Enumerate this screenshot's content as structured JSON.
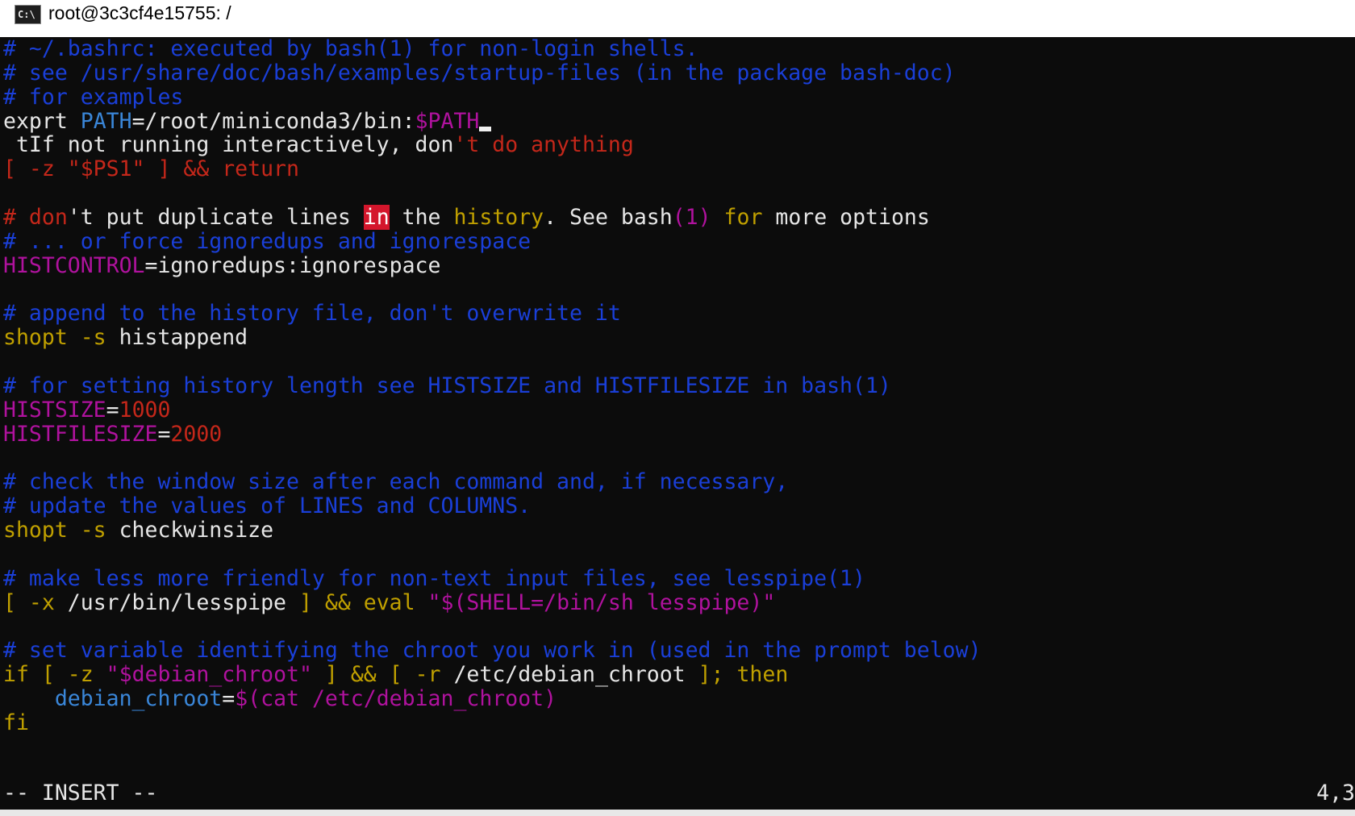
{
  "window": {
    "title": "root@3c3cf4e15755: /",
    "icon_name": "cmd-icon",
    "icon_label": "C:\\"
  },
  "editor": {
    "mode": "-- INSERT --",
    "cursor_position": "4,3"
  },
  "colors": {
    "comment": "#1a3fd8",
    "variable": "#b0129e",
    "string": "#c4271a",
    "keyword": "#c0a000",
    "identifier": "#3a86d8",
    "highlight": "#d4162c"
  },
  "lines": [
    [
      {
        "t": "# ~/.bashrc: executed by bash(1) for non-login shells.",
        "c": "com"
      }
    ],
    [
      {
        "t": "# see /usr/share/doc/bash/examples/startup-files (in the package bash-doc)",
        "c": "com"
      }
    ],
    [
      {
        "t": "# for examples",
        "c": "com"
      }
    ],
    [
      {
        "t": "exprt ",
        "c": "wht"
      },
      {
        "t": "PATH",
        "c": "blu"
      },
      {
        "t": "=/root/miniconda3/bin:",
        "c": "wht"
      },
      {
        "t": "$PATH",
        "c": "mag"
      },
      {
        "t": "",
        "c": "cursor"
      }
    ],
    [
      {
        "t": " tIf not running interactively, don",
        "c": "wht"
      },
      {
        "t": "'t do anything",
        "c": "red"
      }
    ],
    [
      {
        "t": "[ -z \"$PS1\" ] && return",
        "c": "red"
      }
    ],
    [],
    [
      {
        "t": "# ",
        "c": "red"
      },
      {
        "t": "don",
        "c": "red"
      },
      {
        "t": "'t put duplicate lines ",
        "c": "wht"
      },
      {
        "t": "in",
        "c": "hl"
      },
      {
        "t": " the ",
        "c": "wht"
      },
      {
        "t": "history",
        "c": "yel"
      },
      {
        "t": ". See bash",
        "c": "wht"
      },
      {
        "t": "(1)",
        "c": "mag"
      },
      {
        "t": " ",
        "c": "wht"
      },
      {
        "t": "for",
        "c": "yel"
      },
      {
        "t": " more options",
        "c": "wht"
      }
    ],
    [
      {
        "t": "# ... or force ignoredups and ignorespace",
        "c": "com"
      }
    ],
    [
      {
        "t": "HISTCONTROL",
        "c": "mag"
      },
      {
        "t": "=ignoredups:ignorespace",
        "c": "wht"
      }
    ],
    [],
    [
      {
        "t": "# append to the history file, don't overwrite it",
        "c": "com"
      }
    ],
    [
      {
        "t": "shopt -s",
        "c": "yel"
      },
      {
        "t": " histappend",
        "c": "wht"
      }
    ],
    [],
    [
      {
        "t": "# for setting history length see HISTSIZE and HISTFILESIZE in bash(1)",
        "c": "com"
      }
    ],
    [
      {
        "t": "HISTSIZE",
        "c": "mag"
      },
      {
        "t": "=",
        "c": "wht"
      },
      {
        "t": "1000",
        "c": "red"
      }
    ],
    [
      {
        "t": "HISTFILESIZE",
        "c": "mag"
      },
      {
        "t": "=",
        "c": "wht"
      },
      {
        "t": "2000",
        "c": "red"
      }
    ],
    [],
    [
      {
        "t": "# check the window size after each command and, if necessary,",
        "c": "com"
      }
    ],
    [
      {
        "t": "# update the values of LINES and COLUMNS.",
        "c": "com"
      }
    ],
    [
      {
        "t": "shopt -s",
        "c": "yel"
      },
      {
        "t": " checkwinsize",
        "c": "wht"
      }
    ],
    [],
    [
      {
        "t": "# make less more friendly for non-text input files, see lesspipe(1)",
        "c": "com"
      }
    ],
    [
      {
        "t": "[ -x",
        "c": "yel"
      },
      {
        "t": " /usr/bin/lesspipe ",
        "c": "wht"
      },
      {
        "t": "] && eval",
        "c": "yel"
      },
      {
        "t": " ",
        "c": "wht"
      },
      {
        "t": "\"$(SHELL=/bin/sh lesspipe)\"",
        "c": "mag"
      }
    ],
    [],
    [
      {
        "t": "# set variable identifying the chroot you work in (used in the prompt below)",
        "c": "com"
      }
    ],
    [
      {
        "t": "if [ -z",
        "c": "yel"
      },
      {
        "t": " ",
        "c": "wht"
      },
      {
        "t": "\"$debian_chroot\"",
        "c": "mag"
      },
      {
        "t": " ",
        "c": "wht"
      },
      {
        "t": "] && [ -r",
        "c": "yel"
      },
      {
        "t": " /etc/debian_chroot ",
        "c": "wht"
      },
      {
        "t": "]; then",
        "c": "yel"
      }
    ],
    [
      {
        "t": "    ",
        "c": "wht"
      },
      {
        "t": "debian_chroot",
        "c": "blu"
      },
      {
        "t": "=",
        "c": "wht"
      },
      {
        "t": "$(cat /etc/debian_chroot)",
        "c": "mag"
      }
    ],
    [
      {
        "t": "fi",
        "c": "yel"
      }
    ]
  ]
}
